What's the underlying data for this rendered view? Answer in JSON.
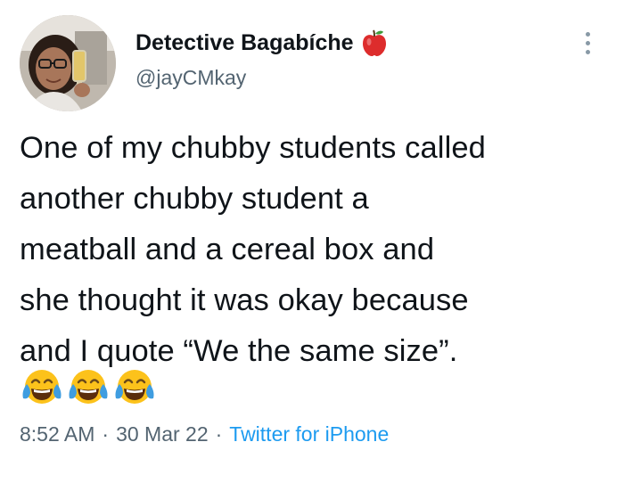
{
  "tweet": {
    "display_name": "Detective Bagabíche",
    "name_emoji_icon": "red-apple-icon",
    "handle": "@jayCMkay",
    "text_lines": [
      "One of my chubby students called",
      "another chubby student a",
      "meatball and a cereal box and",
      "she thought it was okay because",
      "and I quote “We the same size”."
    ],
    "emojis": [
      "tears-of-joy-icon",
      "tears-of-joy-icon",
      "tears-of-joy-icon"
    ],
    "time": "8:52 AM",
    "separator": "·",
    "date": "30 Mar 22",
    "source": "Twitter for iPhone"
  },
  "colors": {
    "text": "#0f1419",
    "secondary": "#536471",
    "link": "#1d9bf0",
    "more_dots": "#8899a6"
  }
}
